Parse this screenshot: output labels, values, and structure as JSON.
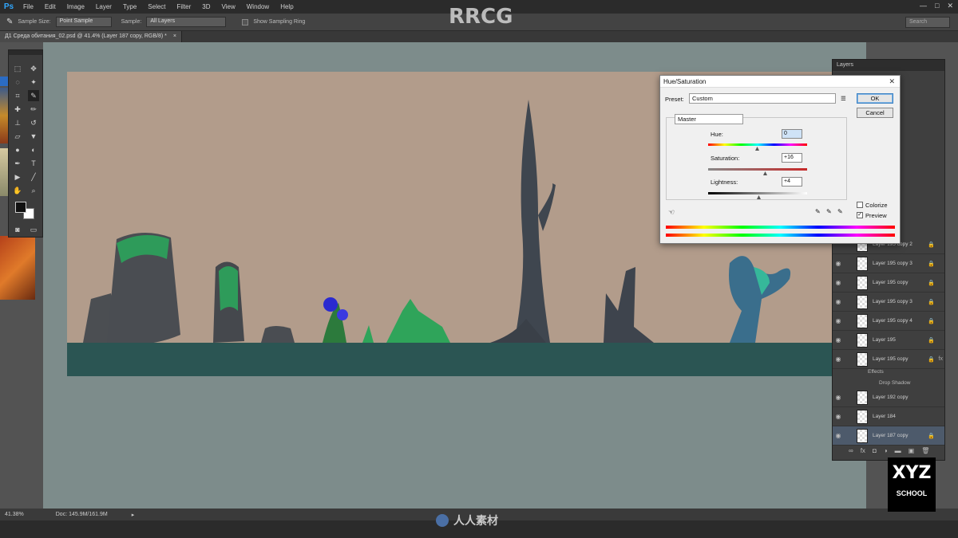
{
  "app": {
    "logo": "Ps",
    "menu": [
      "File",
      "Edit",
      "Image",
      "Layer",
      "Type",
      "Select",
      "Filter",
      "3D",
      "View",
      "Window",
      "Help"
    ],
    "window_controls": [
      "—",
      "□",
      "✕"
    ]
  },
  "options_bar": {
    "sample_size_label": "Sample Size:",
    "sample_size_value": "Point Sample",
    "sample_label": "Sample:",
    "sample_value": "All Layers",
    "show_ring_label": "Show Sampling Ring",
    "search_placeholder": "Search"
  },
  "document": {
    "tab_title": "Д1 Среда обитания_02.psd @ 41.4% (Layer 187 copy, RGB/8) *",
    "tab_close": "×"
  },
  "status_bar": {
    "zoom": "41.38%",
    "doc_info": "Doc: 145.9M/161.9M",
    "arrow": "▸"
  },
  "layers_panel": {
    "title": "Layers",
    "rows": [
      {
        "name": "Layer 195 copy 2",
        "visible": false,
        "locked": true
      },
      {
        "name": "Layer 195 copy 3",
        "visible": true,
        "locked": true
      },
      {
        "name": "Layer 195 copy",
        "visible": true,
        "locked": true
      },
      {
        "name": "Layer 195 copy 3",
        "visible": true,
        "locked": true
      },
      {
        "name": "Layer 195 copy 4",
        "visible": true,
        "locked": true
      },
      {
        "name": "Layer 195",
        "visible": true,
        "locked": true
      },
      {
        "name": "Layer 195 copy",
        "visible": true,
        "locked": true,
        "fx": "fx"
      },
      {
        "name": "Layer 192 copy",
        "visible": true,
        "locked": false
      },
      {
        "name": "Layer 184",
        "visible": true,
        "locked": false
      },
      {
        "name": "Layer 187 copy",
        "visible": true,
        "locked": true,
        "selected": true
      }
    ],
    "effects_label": "Effects",
    "drop_shadow_label": "Drop Shadow"
  },
  "hue_saturation": {
    "title": "Hue/Saturation",
    "close": "✕",
    "preset_label": "Preset:",
    "preset_value": "Custom",
    "channel_value": "Master",
    "hue_label": "Hue:",
    "hue_value": "0",
    "saturation_label": "Saturation:",
    "saturation_value": "+16",
    "lightness_label": "Lightness:",
    "lightness_value": "+4",
    "ok_label": "OK",
    "cancel_label": "Cancel",
    "colorize_label": "Colorize",
    "colorize_checked": false,
    "preview_label": "Preview",
    "preview_checked": true
  },
  "watermarks": {
    "top": "RRCG",
    "bottom": "人人素材",
    "xyz_big": "XYZ",
    "xyz_small": "SCHOOL"
  },
  "colors": {
    "artboard_bg": "#b29c8b",
    "pasteboard": "#7d8c8b",
    "ground": "#2b5553",
    "ps_blue": "#31a8ff"
  }
}
